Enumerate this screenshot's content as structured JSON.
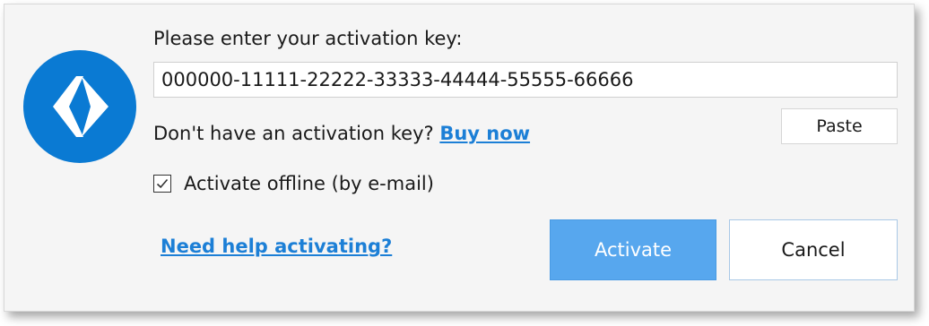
{
  "dialog": {
    "prompt": "Please enter your activation key:",
    "key_value": "000000-11111-22222-33333-44444-55555-66666",
    "no_key_text": "Don't have an activation key? ",
    "buy_now_link": "Buy now",
    "paste_label": "Paste",
    "offline_label": "Activate offline (by e-mail)",
    "offline_checked": true,
    "help_link": "Need help activating?",
    "activate_label": "Activate",
    "cancel_label": "Cancel"
  },
  "icons": {
    "logo": "app-logo-icon",
    "checkmark": "checkmark-icon"
  },
  "colors": {
    "brand_blue": "#0a7ad3",
    "link_blue": "#1c7fd6",
    "activate_button": "#57a7ee",
    "dialog_background": "#f5f5f5"
  }
}
